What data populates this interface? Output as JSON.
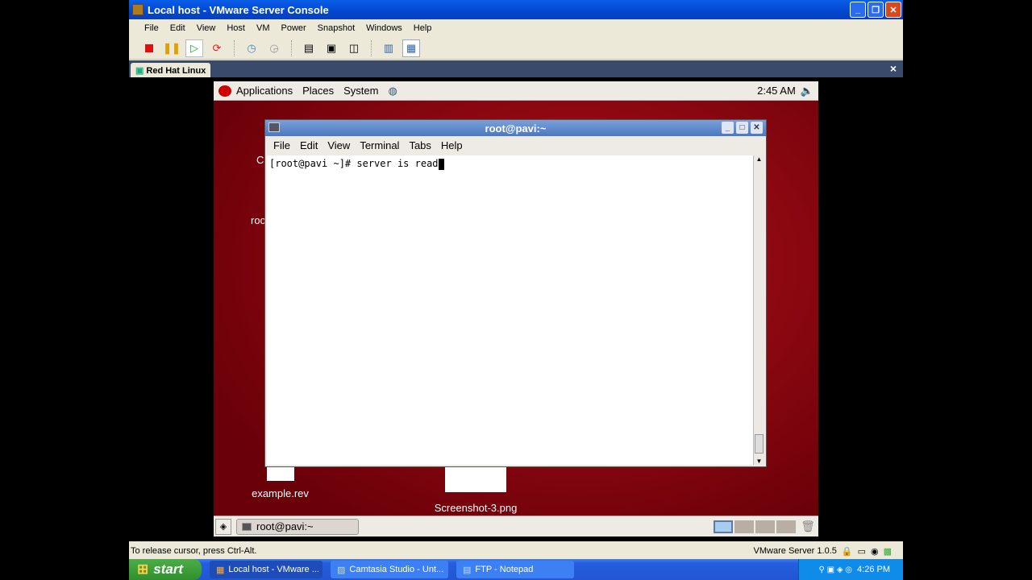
{
  "window": {
    "title": "Local host - VMware Server Console"
  },
  "menu": [
    "File",
    "Edit",
    "View",
    "Host",
    "VM",
    "Power",
    "Snapshot",
    "Windows",
    "Help"
  ],
  "toolbar": [
    "stop-icon",
    "pause-icon",
    "play-icon",
    "reset-icon",
    "snapshot-icon",
    "revert-icon",
    "sidebar-icon",
    "fullscreen-icon",
    "quickswitch-icon",
    "summary-icon",
    "console-icon"
  ],
  "tab": {
    "label": "Red Hat Linux",
    "close": "×"
  },
  "guest": {
    "panel": {
      "applications": "Applications",
      "places": "Places",
      "system": "System",
      "clock": "2:45 AM"
    },
    "desktop_icons": [
      {
        "label": "example.rev"
      },
      {
        "label": "Screenshot-3.png"
      },
      {
        "label": "C"
      },
      {
        "label": "roo"
      }
    ],
    "terminal": {
      "title": "root@pavi:~",
      "menu": [
        "File",
        "Edit",
        "View",
        "Terminal",
        "Tabs",
        "Help"
      ],
      "prompt": "[root@pavi ~]# ",
      "input": "server is read"
    },
    "taskbar": {
      "task": "root@pavi:~",
      "workspaces": 4,
      "active_workspace": 1
    }
  },
  "status": {
    "hint": "To release cursor, press Ctrl-Alt.",
    "version": "VMware Server 1.0.5"
  },
  "xp_taskbar": {
    "start": "start",
    "tasks": [
      "Local host - VMware ...",
      "Camtasia Studio - Unt...",
      "FTP - Notepad"
    ],
    "clock": "4:26 PM"
  }
}
